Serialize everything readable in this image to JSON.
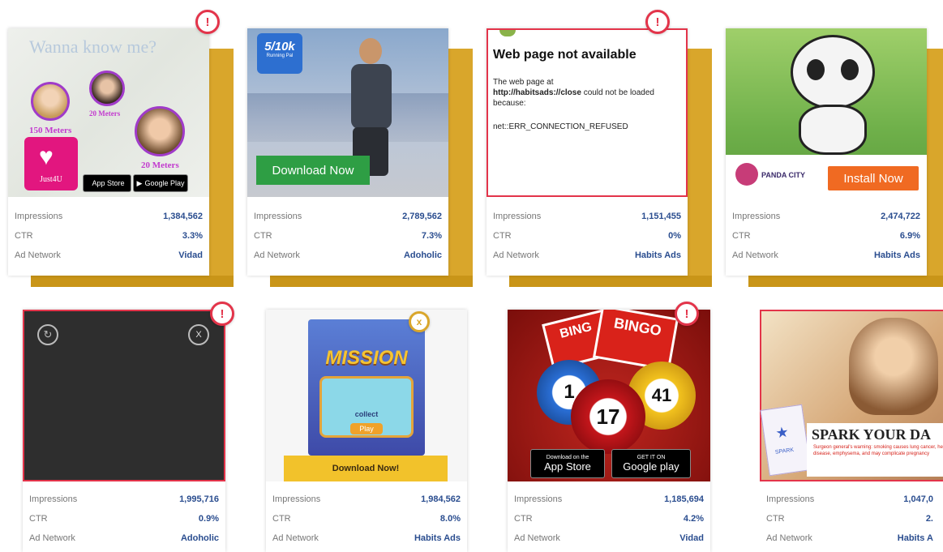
{
  "labels": {
    "impressions": "Impressions",
    "ctr": "CTR",
    "network": "Ad Network"
  },
  "ads": [
    {
      "impressions": "1,384,562",
      "ctr": "3.3%",
      "network": "Vidad",
      "headline": "Wanna know me?",
      "dist1": "150 Meters",
      "dist2": "20 Meters",
      "dist3": "20 Meters",
      "app_name": "Just4U",
      "badge_appstore": "App Store",
      "badge_googleplay": "Google Play"
    },
    {
      "impressions": "2,789,562",
      "ctr": "7.3%",
      "network": "Adoholic",
      "badge_top": "5/10k",
      "badge_sub": "Running Pal",
      "cta": "Download Now"
    },
    {
      "impressions": "1,151,455",
      "ctr": "0%",
      "network": "Habits Ads",
      "error_title": "Web page not available",
      "error_line1": "The web page at",
      "error_url": "http://habitsads://close",
      "error_line2": "could not be loaded because:",
      "error_code": "net::ERR_CONNECTION_REFUSED"
    },
    {
      "impressions": "2,474,722",
      "ctr": "6.9%",
      "network": "Habits Ads",
      "brand": "PANDA CITY",
      "cta": "Install Now"
    },
    {
      "impressions": "1,995,716",
      "ctr": "0.9%",
      "network": "Adoholic",
      "close_label": "X"
    },
    {
      "impressions": "1,984,562",
      "ctr": "8.0%",
      "network": "Habits Ads",
      "game_title": "MISSION",
      "game_sub": "collect",
      "play": "Play",
      "cta": "Download Now!",
      "close_label": "x"
    },
    {
      "impressions": "1,185,694",
      "ctr": "4.2%",
      "network": "Vidad",
      "ticket1": "BING",
      "ticket2": "BINGO",
      "ball1": "1",
      "ball2": "17",
      "ball3": "41",
      "badge_appstore": "App Store",
      "badge_appstore_top": "Download on the",
      "badge_googleplay": "Google play",
      "badge_googleplay_top": "GET IT ON"
    },
    {
      "impressions": "1,047,0",
      "ctr": "2.",
      "network": "Habits A",
      "headline": "SPARK YOUR DA",
      "logo": "SPARK",
      "warning": "Surgeon general's warning: smoking causes lung cancer, heart disease, emphysema, and may complicate pregnancy"
    }
  ],
  "colors": {
    "flag": "#e3344a",
    "slab": "#d9a62b",
    "value": "#2a4d8f",
    "green_cta": "#2e9e44",
    "orange_cta": "#f06a22"
  },
  "icons": [
    "warning-icon",
    "close-icon",
    "refresh-icon",
    "apple-icon",
    "play-store-icon",
    "heart-icon"
  ]
}
